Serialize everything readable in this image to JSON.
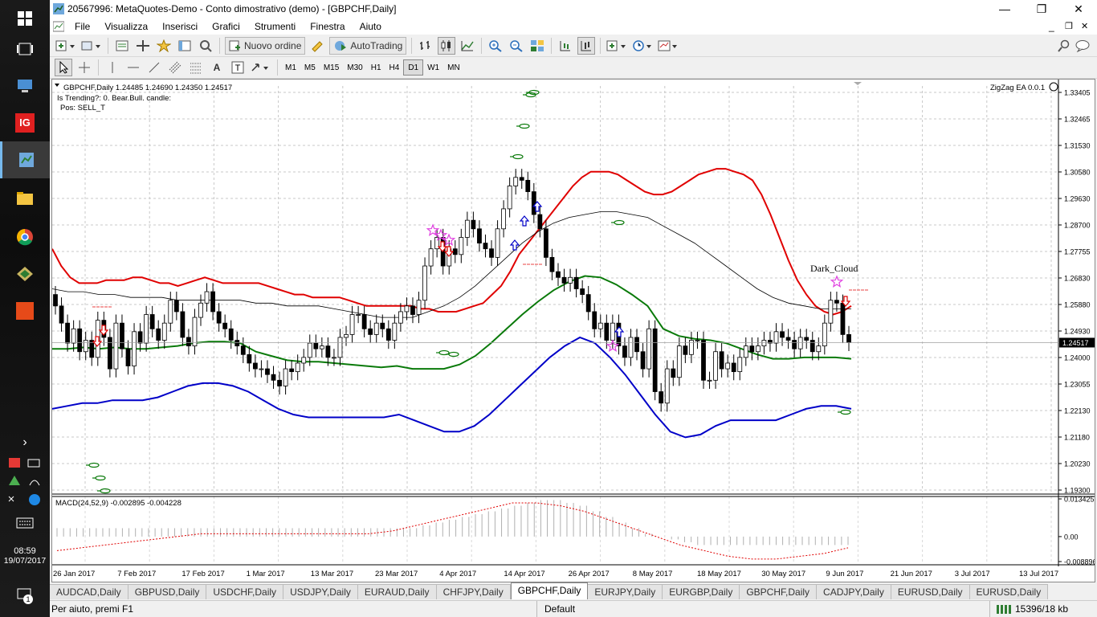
{
  "window": {
    "title": "20567996: MetaQuotes-Demo - Conto dimostrativo (demo) - [GBPCHF,Daily]"
  },
  "menu": [
    "File",
    "Visualizza",
    "Inserisci",
    "Grafici",
    "Strumenti",
    "Finestra",
    "Aiuto"
  ],
  "toolbar": {
    "new_order": "Nuovo ordine",
    "autotrading": "AutoTrading"
  },
  "timeframes": [
    "M1",
    "M5",
    "M15",
    "M30",
    "H1",
    "H4",
    "D1",
    "W1",
    "MN"
  ],
  "selected_timeframe": "D1",
  "clock": {
    "time": "08:59",
    "date": "19/07/2017"
  },
  "chart": {
    "header": "GBPCHF,Daily  1.24485 1.24690 1.24350 1.24517",
    "info_lines": [
      "Is Trending?: 0. Bear.Bull. candle:",
      "Pos: SELL_T"
    ],
    "ea_label": "ZigZag EA 0.0.1",
    "pattern_label": "Dark_Cloud",
    "current_price": "1.24517",
    "macd_label": "MACD(24,52,9) -0.002895 -0.004228",
    "macd_ticks": [
      "0.013425",
      "0.00",
      "-0.008896"
    ],
    "price_ticks": [
      "1.33405",
      "1.32465",
      "1.31530",
      "1.30580",
      "1.29630",
      "1.28700",
      "1.27755",
      "1.26830",
      "1.25880",
      "1.24930",
      "1.24000",
      "1.23055",
      "1.22130",
      "1.21180",
      "1.20230",
      "1.19300"
    ],
    "date_ticks": [
      "26 Jan 2017",
      "7 Feb 2017",
      "17 Feb 2017",
      "1 Mar 2017",
      "13 Mar 2017",
      "23 Mar 2017",
      "4 Apr 2017",
      "14 Apr 2017",
      "26 Apr 2017",
      "8 May 2017",
      "18 May 2017",
      "30 May 2017",
      "9 Jun 2017",
      "21 Jun 2017",
      "3 Jul 2017",
      "13 Jul 2017"
    ]
  },
  "chart_data": {
    "type": "line",
    "symbol": "GBPCHF",
    "timeframe": "Daily",
    "ylim": [
      1.193,
      1.335
    ],
    "price_close": [
      1.258,
      1.252,
      1.245,
      1.25,
      1.242,
      1.246,
      1.24,
      1.253,
      1.247,
      1.236,
      1.252,
      1.243,
      1.237,
      1.249,
      1.245,
      1.255,
      1.25,
      1.246,
      1.252,
      1.26,
      1.256,
      1.247,
      1.244,
      1.254,
      1.259,
      1.263,
      1.256,
      1.252,
      1.25,
      1.246,
      1.244,
      1.241,
      1.238,
      1.236,
      1.236,
      1.234,
      1.232,
      1.23,
      1.236,
      1.235,
      1.238,
      1.24,
      1.245,
      1.243,
      1.244,
      1.24,
      1.24,
      1.247,
      1.248,
      1.255,
      1.255,
      1.25,
      1.248,
      1.252,
      1.25,
      1.246,
      1.252,
      1.256,
      1.258,
      1.255,
      1.26,
      1.272,
      1.278,
      1.282,
      1.272,
      1.278,
      1.276,
      1.282,
      1.288,
      1.285,
      1.28,
      1.278,
      1.275,
      1.285,
      1.292,
      1.3,
      1.303,
      1.302,
      1.298,
      1.29,
      1.285,
      1.275,
      1.27,
      1.268,
      1.266,
      1.268,
      1.264,
      1.262,
      1.256,
      1.25,
      1.252,
      1.246,
      1.252,
      1.244,
      1.24,
      1.247,
      1.242,
      1.236,
      1.25,
      1.228,
      1.224,
      1.236,
      1.233,
      1.244,
      1.241,
      1.246,
      1.246,
      1.232,
      1.232,
      1.242,
      1.236,
      1.238,
      1.235,
      1.24,
      1.244,
      1.242,
      1.244,
      1.246,
      1.245,
      1.249,
      1.247,
      1.246,
      1.243,
      1.247,
      1.246,
      1.242,
      1.244,
      1.252,
      1.26,
      1.259,
      1.248,
      1.2452
    ],
    "bb_upper": [
      1.278,
      1.272,
      1.268,
      1.266,
      1.266,
      1.266,
      1.267,
      1.267,
      1.267,
      1.268,
      1.268,
      1.267,
      1.266,
      1.266,
      1.265,
      1.266,
      1.267,
      1.268,
      1.267,
      1.266,
      1.266,
      1.266,
      1.266,
      1.266,
      1.265,
      1.264,
      1.263,
      1.262,
      1.262,
      1.261,
      1.261,
      1.261,
      1.261,
      1.26,
      1.259,
      1.258,
      1.258,
      1.258,
      1.258,
      1.258,
      1.258,
      1.257,
      1.257,
      1.256,
      1.256,
      1.256,
      1.257,
      1.258,
      1.259,
      1.262,
      1.265,
      1.27,
      1.276,
      1.28,
      1.284,
      1.288,
      1.292,
      1.296,
      1.3,
      1.303,
      1.305,
      1.305,
      1.305,
      1.304,
      1.302,
      1.3,
      1.298,
      1.297,
      1.297,
      1.298,
      1.3,
      1.302,
      1.304,
      1.305,
      1.306,
      1.306,
      1.305,
      1.304,
      1.302,
      1.297,
      1.29,
      1.282,
      1.274,
      1.267,
      1.262,
      1.258,
      1.256,
      1.255,
      1.256,
      1.258
    ],
    "bb_middle": [
      1.264,
      1.263,
      1.263,
      1.262,
      1.262,
      1.261,
      1.261,
      1.261,
      1.26,
      1.26,
      1.26,
      1.26,
      1.26,
      1.259,
      1.259,
      1.258,
      1.258,
      1.258,
      1.257,
      1.256,
      1.255,
      1.254,
      1.254,
      1.254,
      1.256,
      1.258,
      1.261,
      1.265,
      1.27,
      1.275,
      1.28,
      1.284,
      1.287,
      1.289,
      1.29,
      1.291,
      1.291,
      1.29,
      1.289,
      1.286,
      1.283,
      1.28,
      1.276,
      1.272,
      1.268,
      1.264,
      1.261,
      1.259,
      1.258,
      1.257,
      1.257,
      1.257
    ],
    "bb_lower": [
      1.222,
      1.223,
      1.224,
      1.224,
      1.225,
      1.225,
      1.225,
      1.226,
      1.228,
      1.23,
      1.231,
      1.231,
      1.23,
      1.228,
      1.225,
      1.222,
      1.22,
      1.219,
      1.219,
      1.219,
      1.219,
      1.219,
      1.219,
      1.22,
      1.218,
      1.216,
      1.214,
      1.214,
      1.216,
      1.22,
      1.225,
      1.23,
      1.235,
      1.24,
      1.244,
      1.247,
      1.245,
      1.24,
      1.234,
      1.227,
      1.22,
      1.214,
      1.212,
      1.213,
      1.216,
      1.218,
      1.218,
      1.218,
      1.218,
      1.22,
      1.222,
      1.223,
      1.223,
      1.222
    ],
    "macd_histogram": [
      0.003,
      0.003,
      0.003,
      0.003,
      0.003,
      0.003,
      0.003,
      0.003,
      0.003,
      0.003,
      0.003,
      0.003,
      0.003,
      0.003,
      0.003,
      0.003,
      0.003,
      0.003,
      0.003,
      0.003,
      0.003,
      0.003,
      0.003,
      0.003,
      0.003,
      0.003,
      0.003,
      0.003,
      0.004,
      0.005,
      0.006,
      0.007,
      0.008,
      0.009,
      0.01,
      0.011,
      0.012,
      0.013,
      0.013,
      0.012,
      0.011,
      0.009,
      0.007,
      0.005,
      0.003,
      0.001,
      0.0,
      -0.001,
      -0.002,
      -0.003,
      -0.003,
      -0.003,
      -0.003,
      -0.003,
      -0.003,
      -0.003,
      -0.003,
      -0.003,
      -0.003,
      -0.003,
      -0.003
    ],
    "macd_signal": [
      -0.005,
      -0.004,
      -0.003,
      -0.002,
      -0.001,
      0.0,
      0.001,
      0.001,
      0.001,
      0.001,
      0.001,
      0.001,
      0.001,
      0.001,
      0.002,
      0.004,
      0.006,
      0.008,
      0.01,
      0.012,
      0.012,
      0.011,
      0.009,
      0.006,
      0.003,
      0.0,
      -0.003,
      -0.005,
      -0.007,
      -0.008,
      -0.008,
      -0.007,
      -0.006,
      -0.004
    ]
  },
  "tabs": [
    "AUDCAD,Daily",
    "GBPUSD,Daily",
    "USDCHF,Daily",
    "USDJPY,Daily",
    "EURAUD,Daily",
    "CHFJPY,Daily",
    "GBPCHF,Daily",
    "EURJPY,Daily",
    "EURGBP,Daily",
    "GBPCHF,Daily",
    "CADJPY,Daily",
    "EURUSD,Daily",
    "EURUSD,Daily"
  ],
  "active_tab_index": 6,
  "status": {
    "help": "Per aiuto, premi F1",
    "profile": "Default",
    "traffic": "15396/18 kb"
  }
}
